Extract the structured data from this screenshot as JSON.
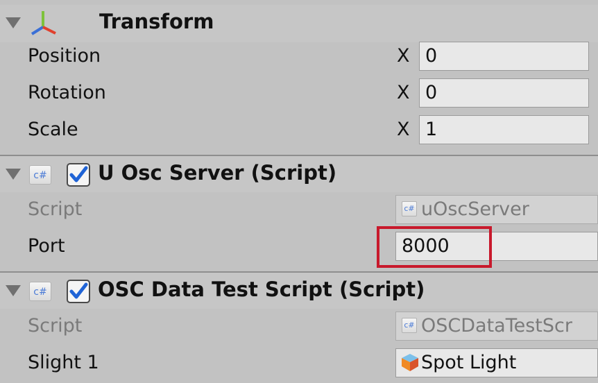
{
  "transform": {
    "title": "Transform",
    "rows": [
      {
        "label": "Position",
        "axis": "X",
        "value": "0"
      },
      {
        "label": "Rotation",
        "axis": "X",
        "value": "0"
      },
      {
        "label": "Scale",
        "axis": "X",
        "value": "1"
      }
    ]
  },
  "osc_server": {
    "title": "U Osc Server (Script)",
    "enabled": true,
    "icon_label": "c#",
    "script_label": "Script",
    "script_value": "uOscServer",
    "port_label": "Port",
    "port_value": "8000"
  },
  "osc_test": {
    "title": "OSC Data Test Script (Script)",
    "enabled": true,
    "icon_label": "c#",
    "script_label": "Script",
    "script_value": "OSCDataTestScr",
    "slight_label": "Slight 1",
    "slight_value": "Spot Light"
  },
  "colors": {
    "highlight": "#c8192c",
    "panel": "#c2c2c2"
  }
}
